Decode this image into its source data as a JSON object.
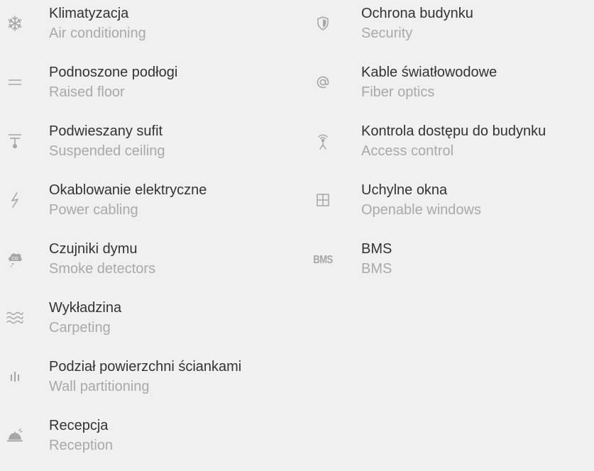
{
  "features_left": [
    {
      "icon": "snowflake-icon",
      "title": "Klimatyzacja",
      "subtitle": "Air conditioning"
    },
    {
      "icon": "raised-floor-icon",
      "title": "Podnoszone podłogi",
      "subtitle": "Raised floor"
    },
    {
      "icon": "ceiling-lamp-icon",
      "title": "Podwieszany sufit",
      "subtitle": "Suspended ceiling"
    },
    {
      "icon": "lightning-icon",
      "title": "Okablowanie elektryczne",
      "subtitle": "Power cabling"
    },
    {
      "icon": "smoke-cloud-icon",
      "title": "Czujniki dymu",
      "subtitle": "Smoke detectors"
    },
    {
      "icon": "waves-icon",
      "title": "Wykładzina",
      "subtitle": "Carpeting"
    },
    {
      "icon": "partition-bars-icon",
      "title": "Podział powierzchni ściankami",
      "subtitle": "Wall partitioning"
    },
    {
      "icon": "reception-bell-icon",
      "title": "Recepcja",
      "subtitle": "Reception"
    }
  ],
  "features_right": [
    {
      "icon": "shield-icon",
      "title": "Ochrona budynku",
      "subtitle": "Security"
    },
    {
      "icon": "at-sign-icon",
      "title": "Kable światłowodowe",
      "subtitle": "Fiber optics"
    },
    {
      "icon": "antenna-icon",
      "title": "Kontrola dostępu do budynku",
      "subtitle": "Access control"
    },
    {
      "icon": "window-icon",
      "title": "Uchylne okna",
      "subtitle": "Openable windows"
    },
    {
      "icon": "bms-icon",
      "icon_text": "BMS",
      "title": "BMS",
      "subtitle": "BMS"
    }
  ],
  "colors": {
    "background": "#f0f0f0",
    "title": "#333333",
    "subtitle": "#a9a9a9",
    "icon": "#a6a6a6"
  }
}
